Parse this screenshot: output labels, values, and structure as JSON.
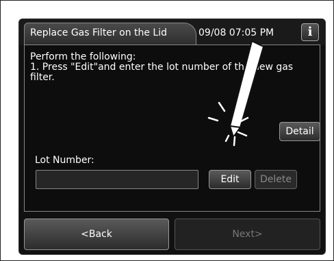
{
  "header": {
    "title": "Replace Gas Filter on the Lid",
    "datetime": "09/08 07:05 PM",
    "info_label": "i"
  },
  "instructions": {
    "line1": "Perform the following:",
    "line2": "1. Press \"Edit\"and enter the lot number of the new gas",
    "line3": "filter."
  },
  "buttons": {
    "detail": "Detail",
    "edit": "Edit",
    "delete": "Delete",
    "back": "<Back",
    "next": "Next>"
  },
  "lot": {
    "label": "Lot Number:",
    "value": ""
  },
  "icons": {
    "info": "info-icon",
    "stylus": "stylus-icon",
    "tap": "tap-indicator-icon"
  }
}
